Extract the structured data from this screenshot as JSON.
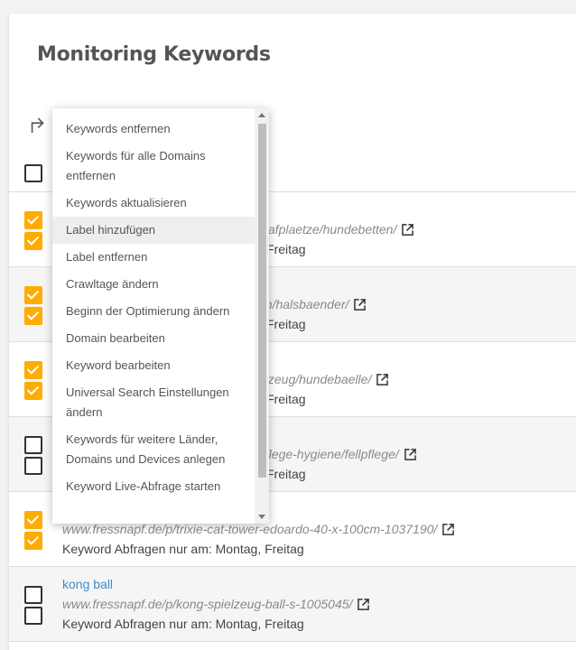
{
  "page": {
    "title": "Monitoring Keywords"
  },
  "icons": {
    "bulk": "subdirectory-arrow-right-icon",
    "external": "open-in-new-icon"
  },
  "colors": {
    "accent": "#ffab00",
    "link": "#3d8ecf"
  },
  "rows": [
    {
      "keyword": "",
      "url": "plafplaetze/hundebetten/",
      "days": "Freitag",
      "check1": true,
      "check2": true
    },
    {
      "keyword": "",
      "url": "en/halsbaender/",
      "days": "Freitag",
      "check1": true,
      "check2": true
    },
    {
      "keyword": "",
      "url": "elzeug/hundebaelle/",
      "days": "Freitag",
      "check1": true,
      "check2": true
    },
    {
      "keyword": "",
      "url": "pflege-hygiene/fellpflege/",
      "days": "Freitag",
      "check1": false,
      "check2": false
    },
    {
      "keyword": "",
      "url": "www.fressnapf.de/p/trixie-cat-tower-edoardo-40-x-100cm-1037190/",
      "days": "Keyword Abfragen nur am: Montag, Freitag",
      "check1": true,
      "check2": true
    },
    {
      "keyword": "kong ball",
      "url": "www.fressnapf.de/p/kong-spielzeug-ball-s-1005045/",
      "days": "Keyword Abfragen nur am: Montag, Freitag",
      "check1": false,
      "check2": false
    }
  ],
  "menu": {
    "items": [
      "Keywords entfernen",
      "Keywords für alle Domains entfernen",
      "Keywords aktualisieren",
      "Label hinzufügen",
      "Label entfernen",
      "Crawltage ändern",
      "Beginn der Optimierung ändern",
      "Domain bearbeiten",
      "Keyword bearbeiten",
      "Universal Search Einstellungen ändern",
      "Keywords für weitere Länder, Domains und Devices anlegen",
      "Keyword Live-Abfrage starten"
    ],
    "hovered_item": "Label hinzufügen"
  }
}
